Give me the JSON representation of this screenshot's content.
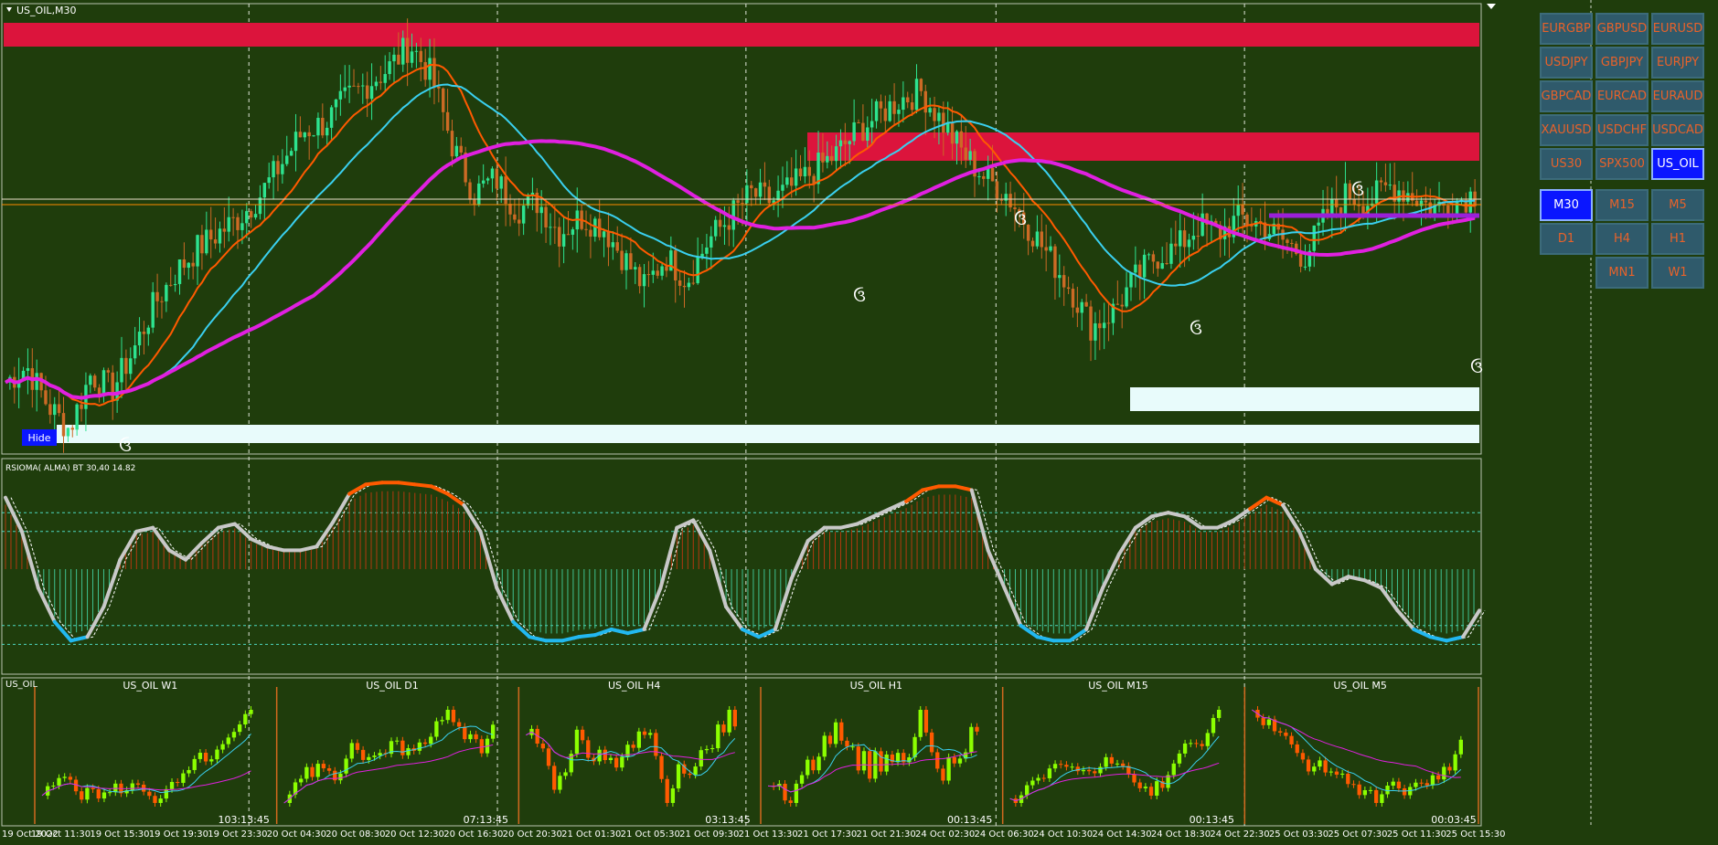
{
  "window": {
    "symbol_title": "US_OIL,M30",
    "indicator_title": "RSIOMA( ALMA) BT 30,40 14.82",
    "mini_panel_title": "US_OIL",
    "hide_label": "Hide"
  },
  "symbol_buttons": [
    {
      "label": "EURGBP",
      "active": false
    },
    {
      "label": "GBPUSD",
      "active": false
    },
    {
      "label": "EURUSD",
      "active": false
    },
    {
      "label": "USDJPY",
      "active": false
    },
    {
      "label": "GBPJPY",
      "active": false
    },
    {
      "label": "EURJPY",
      "active": false
    },
    {
      "label": "GBPCAD",
      "active": false
    },
    {
      "label": "EURCAD",
      "active": false
    },
    {
      "label": "EURAUD",
      "active": false
    },
    {
      "label": "XAUUSD",
      "active": false
    },
    {
      "label": "USDCHF",
      "active": false
    },
    {
      "label": "USDCAD",
      "active": false
    },
    {
      "label": "US30",
      "active": false
    },
    {
      "label": "SPX500",
      "active": false
    },
    {
      "label": "US_OIL",
      "active": true
    }
  ],
  "timeframe_buttons": [
    {
      "label": "M30",
      "active": true
    },
    {
      "label": "M15",
      "active": false
    },
    {
      "label": "M5",
      "active": false
    },
    {
      "label": "D1",
      "active": false
    },
    {
      "label": "H4",
      "active": false
    },
    {
      "label": "H1",
      "active": false
    },
    {
      "label": "",
      "active": false
    },
    {
      "label": "MN1",
      "active": false
    },
    {
      "label": "W1",
      "active": false
    }
  ],
  "colors": {
    "background": "#1f3d0c",
    "bull_candle": "#2de38f",
    "bear_candle": "#cc6a25",
    "supply_zone": "#dc143c",
    "demand_zone": "#e8fbfb",
    "ma_fast": "#ff5a00",
    "ma_mid": "#3ad0f0",
    "ma_slow": "#e020e0",
    "mini_bull": "#8cff00",
    "mini_bear": "#ff5a00",
    "rsi_line": "#c8c8c8",
    "rsi_high": "#ff5a00",
    "rsi_low": "#22b8f0"
  },
  "markers": [
    "ઉ",
    "ઉ",
    "ઉ",
    "ઉ",
    "ઉ",
    "ઉ"
  ],
  "chart_data": [
    {
      "type": "candlestick",
      "title": "US_OIL,M30",
      "time_labels": [
        "19 Oct 2022",
        "19 Oct 11:30",
        "19 Oct 15:30",
        "19 Oct 19:30",
        "19 Oct 23:30",
        "20 Oct 04:30",
        "20 Oct 08:30",
        "20 Oct 12:30",
        "20 Oct 16:30",
        "20 Oct 20:30",
        "21 Oct 01:30",
        "21 Oct 05:30",
        "21 Oct 09:30",
        "21 Oct 13:30",
        "21 Oct 17:30",
        "21 Oct 21:30",
        "24 Oct 02:30",
        "24 Oct 06:30",
        "24 Oct 10:30",
        "24 Oct 14:30",
        "24 Oct 18:30",
        "24 Oct 22:30",
        "25 Oct 03:30",
        "25 Oct 07:30",
        "25 Oct 11:30",
        "25 Oct 15:30"
      ],
      "price_path": [
        56,
        58,
        53,
        50,
        57,
        55,
        60,
        66,
        70,
        73,
        75,
        77,
        80,
        84,
        88,
        89,
        92,
        94,
        96,
        99,
        95,
        86,
        80,
        82,
        78,
        79,
        75,
        77,
        76,
        72,
        68,
        72,
        69,
        74,
        77,
        80,
        79,
        81,
        83,
        85,
        88,
        90,
        92,
        93,
        89,
        85,
        82,
        80,
        76,
        72,
        68,
        63,
        65,
        69,
        72,
        73,
        76,
        75,
        77,
        76,
        74,
        72,
        77,
        80,
        79,
        81,
        80,
        78,
        79,
        80
      ],
      "zones": [
        {
          "kind": "supply",
          "from": 0,
          "to": 1
        },
        {
          "kind": "supply",
          "from": 0.47,
          "to": 1
        },
        {
          "kind": "demand",
          "from": 0.66,
          "to": 1
        },
        {
          "kind": "demand",
          "from": 0.03,
          "to": 1
        }
      ]
    },
    {
      "type": "line",
      "title": "RSIOMA( ALMA) BT 30,40 14.82",
      "levels": [
        80,
        70,
        20,
        10
      ],
      "values": [
        88,
        70,
        40,
        22,
        12,
        14,
        30,
        55,
        70,
        72,
        60,
        55,
        64,
        72,
        74,
        66,
        62,
        60,
        60,
        62,
        75,
        90,
        95,
        96,
        96,
        95,
        94,
        90,
        84,
        70,
        40,
        22,
        14,
        12,
        12,
        14,
        15,
        18,
        16,
        18,
        40,
        72,
        76,
        60,
        30,
        18,
        14,
        18,
        45,
        65,
        72,
        72,
        74,
        78,
        82,
        86,
        92,
        94,
        94,
        92,
        60,
        40,
        20,
        14,
        12,
        12,
        18,
        40,
        58,
        72,
        78,
        80,
        78,
        72,
        72,
        76,
        82,
        88,
        84,
        70,
        50,
        42,
        46,
        44,
        40,
        28,
        18,
        14,
        12,
        14,
        28
      ]
    },
    {
      "type": "candlestick",
      "title": "US_OIL",
      "panels": [
        {
          "label": "US_OIL W1",
          "timer": "103:13:45"
        },
        {
          "label": "US_OIL D1",
          "timer": "07:13:45"
        },
        {
          "label": "US_OIL H4",
          "timer": "03:13:45"
        },
        {
          "label": "US_OIL H1",
          "timer": "00:13:45"
        },
        {
          "label": "US_OIL M15",
          "timer": "00:13:45"
        },
        {
          "label": "US_OIL M5",
          "timer": "00:03:45"
        }
      ]
    }
  ]
}
